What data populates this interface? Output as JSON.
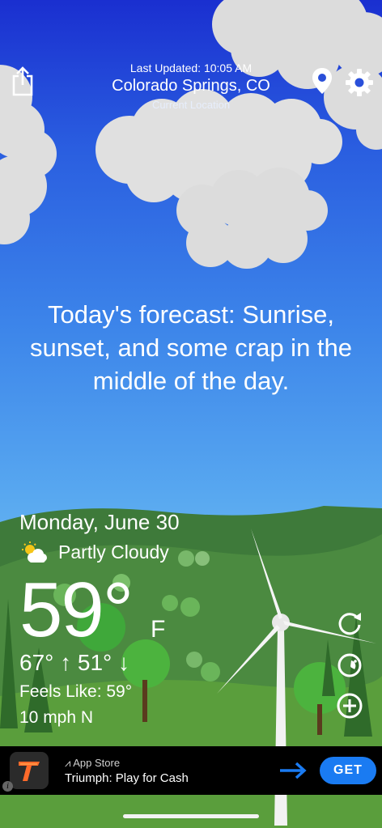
{
  "header": {
    "last_updated": "Last Updated: 10:05 AM",
    "city": "Colorado Springs, CO",
    "current_location": "Current Location"
  },
  "icons": {
    "share": "share-icon",
    "location": "location-pin-icon",
    "settings": "gear-icon",
    "refresh": "refresh-icon",
    "radar": "radar-icon",
    "add": "plus-circle-icon",
    "condition": "partly-cloudy-icon"
  },
  "forecast_text": "Today's forecast: Sunrise, sunset, and some crap in the middle of the day.",
  "weather": {
    "date": "Monday, June 30",
    "condition": "Partly Cloudy",
    "temperature": "59°",
    "unit": "F",
    "hi_lo": "67° ↑  51° ↓",
    "feels_like": "Feels Like: 59°",
    "wind": "10 mph N"
  },
  "ad": {
    "store_label": "App Store",
    "app_name": "Triumph: Play for Cash",
    "get_label": "GET",
    "info_label": "i"
  },
  "colors": {
    "accent": "#1a7bf2",
    "sky_top": "#1a2fd0",
    "sky_bottom": "#6cb9f2",
    "hills": "#4d8a3c"
  }
}
